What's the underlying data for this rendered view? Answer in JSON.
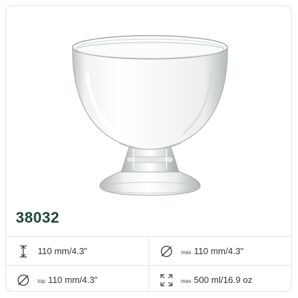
{
  "product": {
    "code": "38032"
  },
  "specs": {
    "height": {
      "label": "",
      "value": "110 mm/4.3\"",
      "icon": "height-icon"
    },
    "max_diameter": {
      "label": "max",
      "value": "110 mm/4.3\"",
      "icon": "diameter-icon"
    },
    "top_diameter": {
      "label": "top",
      "value": "110 mm/4.3\"",
      "icon": "diameter-icon"
    },
    "capacity": {
      "label": "max",
      "value": "500 ml/16.9 oz",
      "icon": "capacity-icon"
    }
  },
  "colors": {
    "accent": "#1e4636",
    "border": "#e3e3e3"
  }
}
